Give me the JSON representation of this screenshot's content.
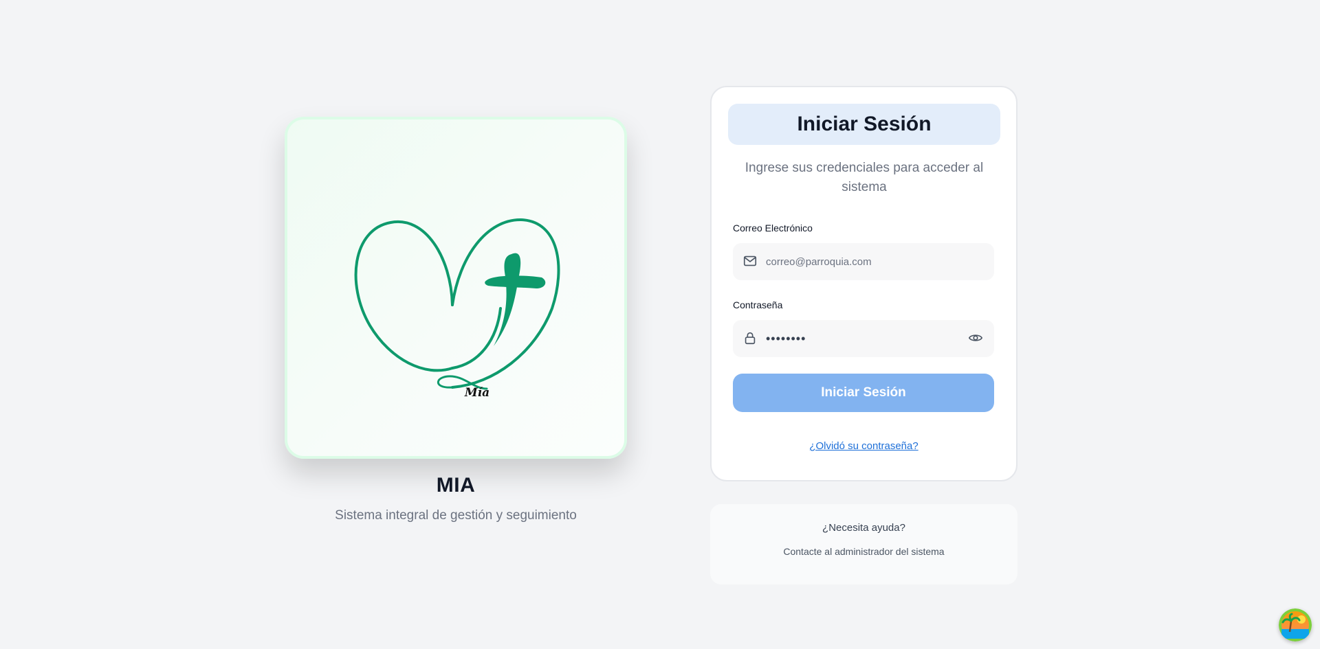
{
  "brand": {
    "logo_text": "Mía",
    "app_name": "MIA",
    "tagline": "Sistema integral de gestión y seguimiento"
  },
  "login": {
    "title": "Iniciar Sesión",
    "subtitle": "Ingrese sus credenciales para acceder al sistema",
    "email": {
      "label": "Correo Electrónico",
      "placeholder": "correo@parroquia.com",
      "value": ""
    },
    "password": {
      "label": "Contraseña",
      "value": "••••••••"
    },
    "submit_label": "Iniciar Sesión",
    "forgot_label": "¿Olvidó su contraseña?"
  },
  "help": {
    "title": "¿Necesita ayuda?",
    "text": "Contacte al administrador del sistema"
  },
  "colors": {
    "brand_green": "#0e9a6c",
    "primary_button": "#82b3f0",
    "link": "#1d6fd8",
    "header_bg": "#e3edfa"
  }
}
